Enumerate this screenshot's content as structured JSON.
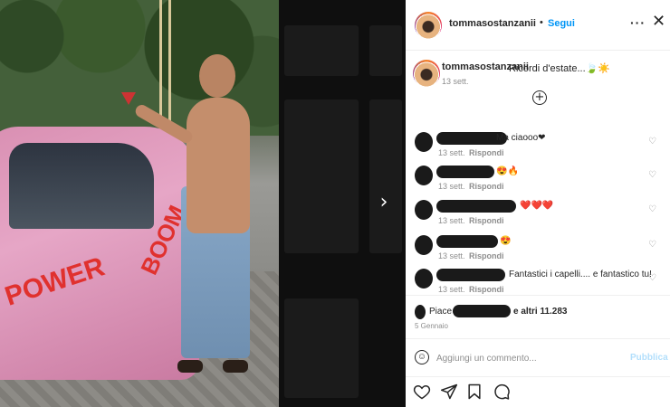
{
  "header": {
    "username": "tommasostanzanii",
    "dot": "•",
    "follow_label": "Segui",
    "more_label": "···",
    "close_label": "✕"
  },
  "caption": {
    "username": "tommasostanzanii",
    "text": "Ricordi d'estate...🍃☀️",
    "time": "13 sett.",
    "load_more_label": "+"
  },
  "comments": [
    {
      "text": "Ma ciaooo❤",
      "time": "13 sett.",
      "reply": "Rispondi"
    },
    {
      "text": "😍🔥",
      "time": "13 sett.",
      "reply": "Rispondi"
    },
    {
      "text": "❤️❤️❤️",
      "time": "13 sett.",
      "reply": "Rispondi"
    },
    {
      "text": "😍",
      "time": "13 sett.",
      "reply": "Rispondi"
    },
    {
      "text": "Fantastici i capelli.... e fantastico tu!",
      "time": "13 sett.",
      "reply": "Rispondi"
    }
  ],
  "likes": {
    "prefix": "Piace a",
    "suffix": "e altri 11.283",
    "date": "5 Gennaio"
  },
  "add_comment": {
    "emoji_label": "☺",
    "placeholder": "Aggiungi un commento...",
    "publish_label": "Pubblica"
  },
  "photo": {
    "graffiti_1": "POWER",
    "graffiti_2": "BOOM"
  },
  "navigation": {
    "next_label": "›"
  },
  "icons": {
    "like": "heart-icon",
    "comment": "comment-icon",
    "share": "paper-plane-icon",
    "save": "bookmark-icon"
  }
}
